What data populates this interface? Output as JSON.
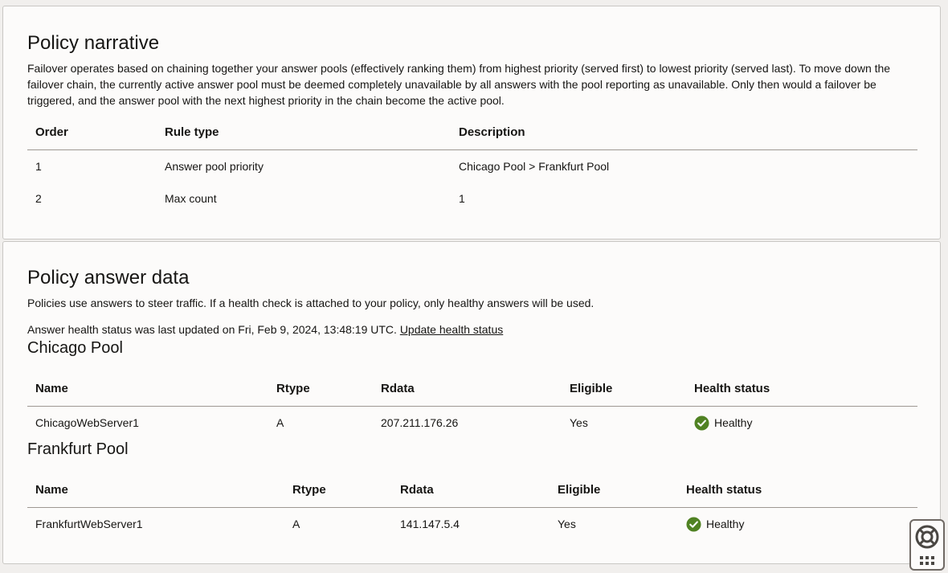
{
  "narrative": {
    "title": "Policy narrative",
    "description": "Failover operates based on chaining together your answer pools (effectively ranking them) from highest priority (served first) to lowest priority (served last). To move down the failover chain, the currently active answer pool must be deemed completely unavailable by all answers with the pool reporting as unavailable. Only then would a failover be triggered, and the answer pool with the next highest priority in the chain become the active pool.",
    "columns": [
      "Order",
      "Rule type",
      "Description"
    ],
    "rows": [
      [
        "1",
        "Answer pool priority",
        "Chicago Pool > Frankfurt Pool"
      ],
      [
        "2",
        "Max count",
        "1"
      ]
    ]
  },
  "answers": {
    "title": "Policy answer data",
    "description": "Policies use answers to steer traffic. If a health check is attached to your policy, only healthy answers will be used.",
    "updated_text": "Answer health status was last updated on Fri, Feb 9, 2024, 13:48:19 UTC.",
    "update_link": "Update health status",
    "pools": [
      {
        "name": "Chicago Pool",
        "columns": [
          "Name",
          "Rtype",
          "Rdata",
          "Eligible",
          "Health status"
        ],
        "rows": [
          [
            "ChicagoWebServer1",
            "A",
            "207.211.176.26",
            "Yes",
            "Healthy"
          ]
        ]
      },
      {
        "name": "Frankfurt Pool",
        "columns": [
          "Name",
          "Rtype",
          "Rdata",
          "Eligible",
          "Health status"
        ],
        "rows": [
          [
            "FrankfurtWebServer1",
            "A",
            "141.147.5.4",
            "Yes",
            "Healthy"
          ]
        ]
      }
    ]
  },
  "icons": {
    "healthy": "check-circle-icon",
    "help": "lifebuoy-icon",
    "apps": "grid-dots-icon"
  },
  "colors": {
    "healthy": "#508223"
  }
}
